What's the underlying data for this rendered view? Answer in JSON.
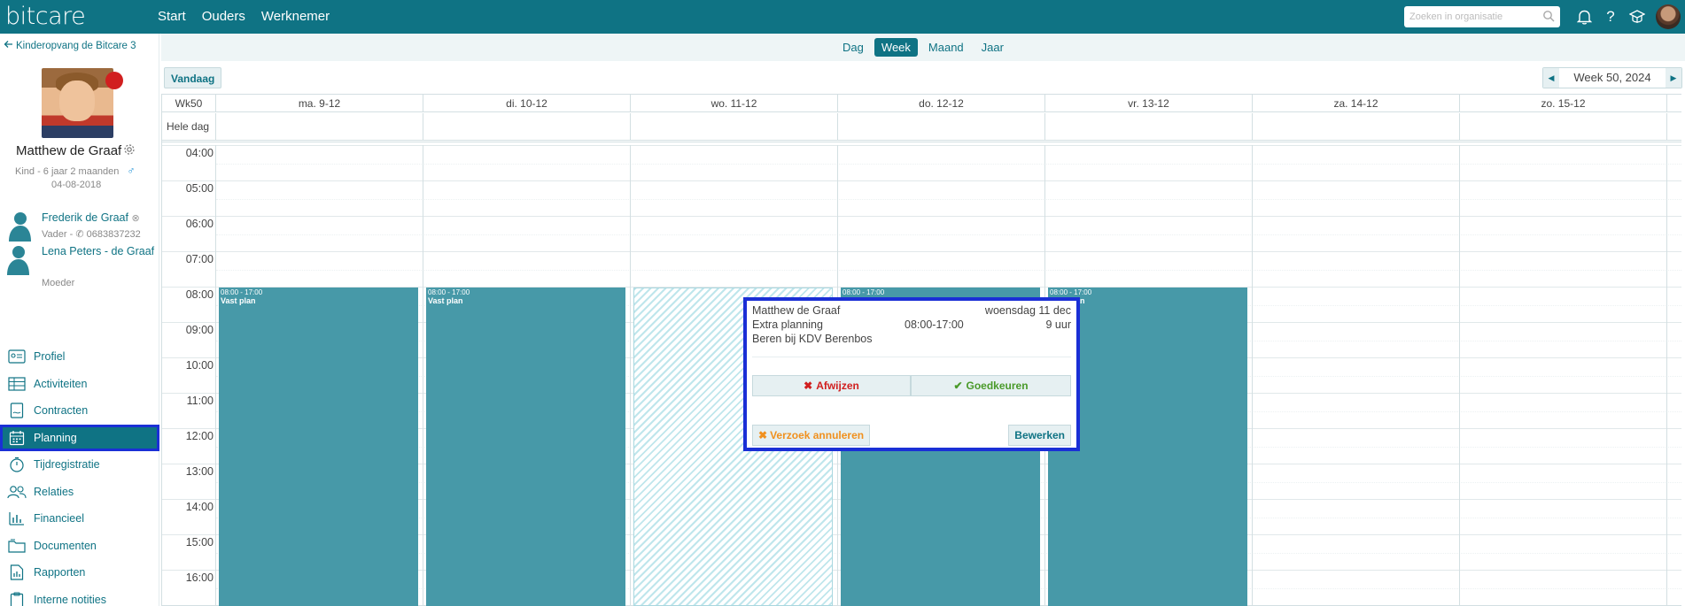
{
  "topbar": {
    "logo": "bitcare",
    "nav": [
      "Start",
      "Ouders",
      "Werknemer"
    ],
    "search_placeholder": "Zoeken in organisatie"
  },
  "sidebar": {
    "back_link": "Kinderopvang de Bitcare 3",
    "child": {
      "name": "Matthew de Graaf",
      "meta": "Kind - 6 jaar 2 maanden",
      "gender_symbol": "♂",
      "dob": "04-08-2018",
      "status_color": "#d11f1f"
    },
    "parents": [
      {
        "name": "Frederik de Graaf",
        "role": "Vader -",
        "phone": "0683837232"
      },
      {
        "name": "Lena Peters - de Graaf",
        "role": "Moeder"
      }
    ],
    "menu": [
      {
        "label": "Profiel",
        "icon": "profile-card-icon"
      },
      {
        "label": "Activiteiten",
        "icon": "table-icon"
      },
      {
        "label": "Contracten",
        "icon": "contract-icon"
      },
      {
        "label": "Planning",
        "icon": "calendar-icon",
        "active": true
      },
      {
        "label": "Tijdregistratie",
        "icon": "stopwatch-icon"
      },
      {
        "label": "Relaties",
        "icon": "people-icon"
      },
      {
        "label": "Financieel",
        "icon": "bar-chart-icon"
      },
      {
        "label": "Documenten",
        "icon": "folder-icon"
      },
      {
        "label": "Rapporten",
        "icon": "report-icon"
      },
      {
        "label": "Interne notities",
        "icon": "clipboard-icon"
      }
    ]
  },
  "view": {
    "buttons": [
      "Dag",
      "Week",
      "Maand",
      "Jaar"
    ],
    "selected": "Week",
    "today_label": "Vandaag",
    "week_label": "Week 50, 2024"
  },
  "calendar": {
    "week_col": "Wk50",
    "days": [
      "ma. 9-12",
      "di. 10-12",
      "wo. 11-12",
      "do. 12-12",
      "vr. 13-12",
      "za. 14-12",
      "zo. 15-12"
    ],
    "allday_label": "Hele dag",
    "hours": [
      "04:00",
      "05:00",
      "06:00",
      "07:00",
      "08:00",
      "09:00",
      "10:00",
      "11:00",
      "12:00",
      "13:00",
      "14:00",
      "15:00",
      "16:00"
    ],
    "block_time": "08:00 - 17:00",
    "block_label": "Vast plan",
    "block_color": "#4799a8"
  },
  "popup": {
    "name": "Matthew de Graaf",
    "date": "woensdag 11 dec",
    "type": "Extra planning",
    "time": "08:00-17:00",
    "duration": "9 uur",
    "location": "Beren bij KDV Berenbos",
    "reject_label": "Afwijzen",
    "approve_label": "Goedkeuren",
    "cancel_label": "Verzoek annuleren",
    "edit_label": "Bewerken",
    "reject_color": "#d11f1f",
    "approve_color": "#4a9a2a",
    "cancel_color": "#f0901e"
  }
}
